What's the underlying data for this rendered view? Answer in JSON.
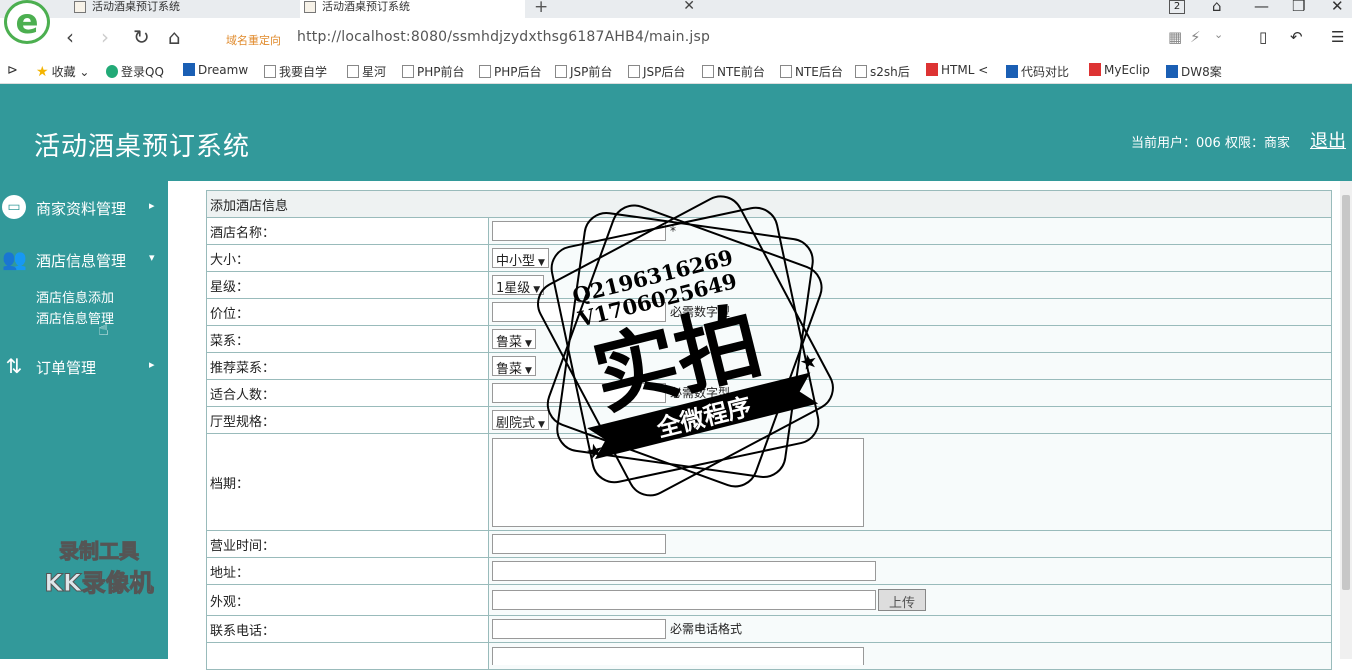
{
  "browser": {
    "tabs": [
      {
        "title": "活动酒桌预订系统",
        "active": false
      },
      {
        "title": "活动酒桌预订系统",
        "active": true
      }
    ],
    "tab_count": "2",
    "redirect_label": "域名重定向",
    "url": "http://localhost:8080/ssmhdjzydxthsg6187AHB4/main.jsp",
    "bookmarks": [
      {
        "label": "收藏",
        "icon": "star-icon"
      },
      {
        "label": "登录QQ",
        "icon": "qq-icon"
      },
      {
        "label": "Dreamw",
        "icon": "dreamweaver-icon"
      },
      {
        "label": "我要自学",
        "icon": "page-icon"
      },
      {
        "label": "星河",
        "icon": "page-icon"
      },
      {
        "label": "PHP前台",
        "icon": "page-icon"
      },
      {
        "label": "PHP后台",
        "icon": "page-icon"
      },
      {
        "label": "JSP前台",
        "icon": "page-icon"
      },
      {
        "label": "JSP后台",
        "icon": "page-icon"
      },
      {
        "label": "NTE前台",
        "icon": "page-icon"
      },
      {
        "label": "NTE后台",
        "icon": "page-icon"
      },
      {
        "label": "s2sh后",
        "icon": "page-icon"
      },
      {
        "label": "HTML <",
        "icon": "html-icon"
      },
      {
        "label": "代码对比",
        "icon": "compare-icon"
      },
      {
        "label": "MyEclip",
        "icon": "myeclipse-icon"
      },
      {
        "label": "DW8案",
        "icon": "paw-icon"
      }
    ]
  },
  "header": {
    "title": "活动酒桌预订系统",
    "user_info": "当前用户：006 权限：商家",
    "logout": "退出"
  },
  "sidebar": {
    "menus": [
      {
        "label": "商家资料管理",
        "icon": "monitor-icon",
        "expanded": false
      },
      {
        "label": "酒店信息管理",
        "icon": "users-icon",
        "expanded": true
      },
      {
        "label": "订单管理",
        "icon": "sort-icon",
        "expanded": false
      }
    ],
    "submenu": [
      "酒店信息添加",
      "酒店信息管理"
    ],
    "watermark": [
      "录制工具",
      "KK录像机"
    ]
  },
  "form": {
    "caption": "添加酒店信息",
    "fields": [
      {
        "label": "酒店名称：",
        "type": "text",
        "value": "",
        "hint": "*"
      },
      {
        "label": "大小：",
        "type": "select",
        "value": "中小型"
      },
      {
        "label": "星级：",
        "type": "select",
        "value": "1星级"
      },
      {
        "label": "价位：",
        "type": "text",
        "value": "",
        "hint": "必需数字型"
      },
      {
        "label": "菜系：",
        "type": "select",
        "value": "鲁菜"
      },
      {
        "label": "推荐菜系：",
        "type": "select",
        "value": "鲁菜"
      },
      {
        "label": "适合人数：",
        "type": "text",
        "value": "",
        "hint": "必需数字型"
      },
      {
        "label": "厅型规格：",
        "type": "select",
        "value": "剧院式"
      },
      {
        "label": "档期：",
        "type": "textarea",
        "value": ""
      },
      {
        "label": "营业时间：",
        "type": "text",
        "value": ""
      },
      {
        "label": "地址：",
        "type": "text",
        "value": ""
      },
      {
        "label": "外观：",
        "type": "upload",
        "value": "",
        "button": "上传"
      },
      {
        "label": "联系电话：",
        "type": "text",
        "value": "",
        "hint": "必需电话格式"
      }
    ]
  },
  "stamp": {
    "line1": "Q2196316269",
    "line2": "V1706025649",
    "big": "实拍",
    "ribbon": "全微程序"
  },
  "colors": {
    "theme": "#32999a",
    "stamp": "#000000"
  }
}
